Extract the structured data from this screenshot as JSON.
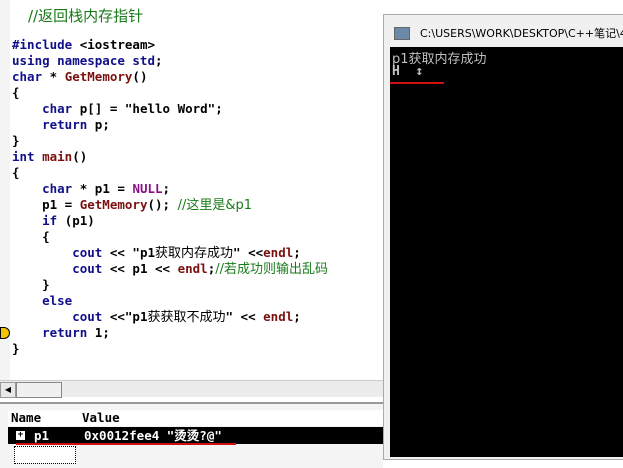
{
  "editor": {
    "header_comment": "//返回栈内存指针",
    "lines": [
      [
        [
          "kw",
          "#include "
        ],
        [
          "tx",
          "<iostream>"
        ]
      ],
      [
        [
          "kw",
          "using namespace std"
        ],
        [
          "tx",
          ";"
        ]
      ],
      [
        [
          "kw",
          "char"
        ],
        [
          "tx",
          " * "
        ],
        [
          "fn",
          "GetMemory"
        ],
        [
          "tx",
          "()"
        ]
      ],
      [
        [
          "tx",
          "{"
        ]
      ],
      [
        [
          "tx",
          "    "
        ],
        [
          "kw",
          "char"
        ],
        [
          "tx",
          " p[] = \"hello Word\";"
        ]
      ],
      [
        [
          "tx",
          "    "
        ],
        [
          "kw",
          "return"
        ],
        [
          "tx",
          " p;"
        ]
      ],
      [
        [
          "tx",
          "}"
        ]
      ],
      [
        [
          "kw",
          "int"
        ],
        [
          "tx",
          " "
        ],
        [
          "fn",
          "main"
        ],
        [
          "tx",
          "()"
        ]
      ],
      [
        [
          "tx",
          "{"
        ]
      ],
      [
        [
          "tx",
          "    "
        ],
        [
          "kw",
          "char"
        ],
        [
          "tx",
          " * p1 = "
        ],
        [
          "mac",
          "NULL"
        ],
        [
          "tx",
          ";"
        ]
      ],
      [
        [
          "tx",
          "    p1 = "
        ],
        [
          "fn",
          "GetMemory"
        ],
        [
          "tx",
          "(); "
        ],
        [
          "cm",
          "//这里是&p1"
        ]
      ],
      [
        [
          "tx",
          "    "
        ],
        [
          "kw",
          "if"
        ],
        [
          "tx",
          " (p1)"
        ]
      ],
      [
        [
          "tx",
          "    {"
        ]
      ],
      [
        [
          "tx",
          "        "
        ],
        [
          "kw",
          "cout"
        ],
        [
          "tx",
          " << \"p1"
        ],
        [
          "str-cn",
          "获取内存成功"
        ],
        [
          "tx",
          "\" <<"
        ],
        [
          "fn",
          "endl"
        ],
        [
          "tx",
          ";"
        ]
      ],
      [
        [
          "tx",
          "        "
        ],
        [
          "kw",
          "cout"
        ],
        [
          "tx",
          " << p1 << "
        ],
        [
          "fn",
          "endl"
        ],
        [
          "tx",
          ";"
        ],
        [
          "cm",
          "//若成功则输出乱码"
        ]
      ],
      [
        [
          "tx",
          "    }"
        ]
      ],
      [
        [
          "tx",
          "    "
        ],
        [
          "kw",
          "else"
        ]
      ],
      [
        [
          "tx",
          "        "
        ],
        [
          "kw",
          "cout"
        ],
        [
          "tx",
          " <<\"p1"
        ],
        [
          "str-cn",
          "获获取不成功"
        ],
        [
          "tx",
          "\" << "
        ],
        [
          "fn",
          "endl"
        ],
        [
          "tx",
          ";"
        ]
      ],
      [
        [
          "tx",
          "    "
        ],
        [
          "kw",
          "return"
        ],
        [
          "tx",
          " 1;"
        ]
      ],
      [
        [
          "tx",
          "}"
        ]
      ]
    ]
  },
  "watch": {
    "col_name": "Name",
    "col_value": "Value",
    "rows": [
      {
        "name": "p1",
        "value": "0x0012fee4 \"烫烫?@\""
      }
    ]
  },
  "console": {
    "title": "C:\\USERS\\WORK\\DESKTOP\\C++笔记\\4\\",
    "output": [
      "p1获取内存成功",
      "H  ↕"
    ]
  }
}
